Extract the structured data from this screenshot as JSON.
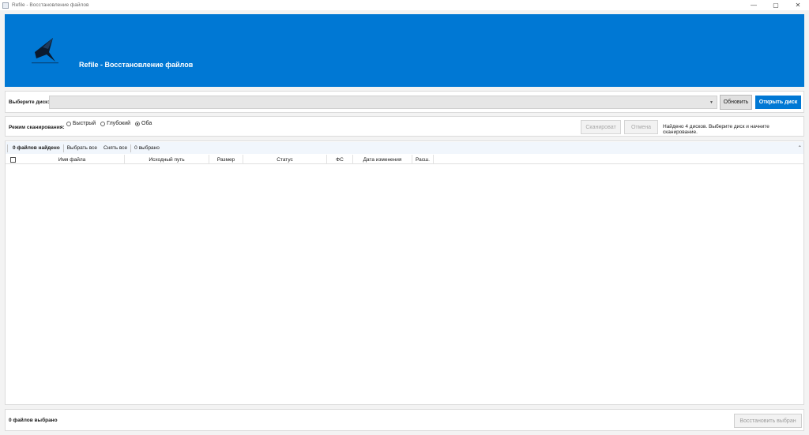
{
  "window": {
    "title": "Refile - Восстановление файлов",
    "controls": [
      "—",
      "▢",
      "✕"
    ]
  },
  "header": {
    "title": "Refile - Восстановление файлов",
    "accent_color": "#0078d4"
  },
  "disk": {
    "label": "Выберите диск:",
    "selected_value": "",
    "refresh_label": "Обновить",
    "open_label": "Открыть диск"
  },
  "scan": {
    "mode_label": "Режим сканирования:",
    "modes": [
      {
        "label": "Быстрый",
        "checked": false
      },
      {
        "label": "Глубокий",
        "checked": false
      },
      {
        "label": "Оба",
        "checked": true
      }
    ],
    "scan_label": "Сканироват",
    "cancel_label": "Отмена",
    "status": "Найдено 4 дисков. Выберите диск и начните сканирование."
  },
  "files": {
    "found_count": "0 файлов найдено",
    "select_all": "Выбрать все",
    "deselect_all": "Снять все",
    "selected_count": "0 выбрано",
    "columns": [
      "Имя файла",
      "Исходный путь",
      "Размер",
      "Статус",
      "ФС",
      "Дата изменения",
      "Расш."
    ],
    "rows": []
  },
  "footer": {
    "selected_text": "0 файлов выбрано",
    "restore_label": "Восстановить выбран"
  }
}
